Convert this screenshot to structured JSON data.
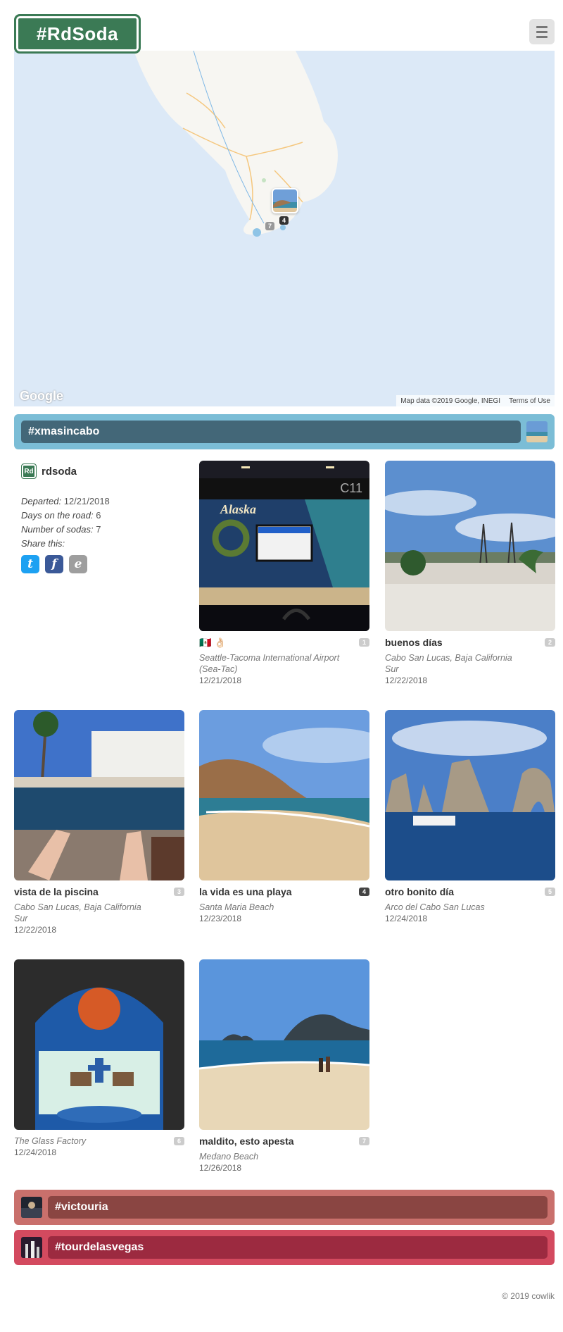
{
  "header": {
    "logo": "#RdSoda"
  },
  "map": {
    "google": "Google",
    "attribution": "Map data ©2019 Google, INEGI",
    "terms": "Terms of Use",
    "marker_count": "4",
    "cluster_count": "7"
  },
  "trips": {
    "current": {
      "name": "#xmasincabo",
      "color": "#7bbdd6",
      "bar_color": "#436778"
    },
    "other": [
      {
        "name": "#victouria",
        "color": "#c9706c",
        "bar_color": "#8a4542"
      },
      {
        "name": "#tourdelasvegas",
        "color": "#d34a5f",
        "bar_color": "#9c2a40"
      }
    ]
  },
  "profile": {
    "avatar": "Rd",
    "username": "rdsoda",
    "departed_label": "Departed:",
    "departed": "12/21/2018",
    "days_label": "Days on the road:",
    "days": "6",
    "sodas_label": "Number of sodas:",
    "sodas": "7",
    "share_label": "Share this:",
    "share": [
      {
        "icon": "twitter-icon",
        "glyph": "t",
        "color": "#1da1f2"
      },
      {
        "icon": "facebook-icon",
        "glyph": "f",
        "color": "#3b5998"
      },
      {
        "icon": "email-icon",
        "glyph": "e",
        "color": "#9e9e9e"
      }
    ]
  },
  "photos": [
    {
      "title": "🇲🇽 👌🏻",
      "num": "1",
      "location": "Seattle-Tacoma International Airport (Sea-Tac)",
      "date": "12/21/2018"
    },
    {
      "title": "buenos días",
      "num": "2",
      "location": "Cabo San Lucas, Baja California Sur",
      "date": "12/22/2018"
    },
    {
      "title": "vista de la piscina",
      "num": "3",
      "location": "Cabo San Lucas, Baja California Sur",
      "date": "12/22/2018"
    },
    {
      "title": "la vida es una playa",
      "num": "4",
      "location": "Santa Maria Beach",
      "date": "12/23/2018"
    },
    {
      "title": "otro bonito día",
      "num": "5",
      "location": "Arco del Cabo San Lucas",
      "date": "12/24/2018"
    },
    {
      "title": "",
      "num": "6",
      "location": "The Glass Factory",
      "date": "12/24/2018"
    },
    {
      "title": "maldito, esto apesta",
      "num": "7",
      "location": "Medano Beach",
      "date": "12/26/2018"
    }
  ],
  "photo_images": {
    "gate_sign": "C11",
    "airline": "Alaska"
  },
  "footer": "© 2019 cowlik"
}
